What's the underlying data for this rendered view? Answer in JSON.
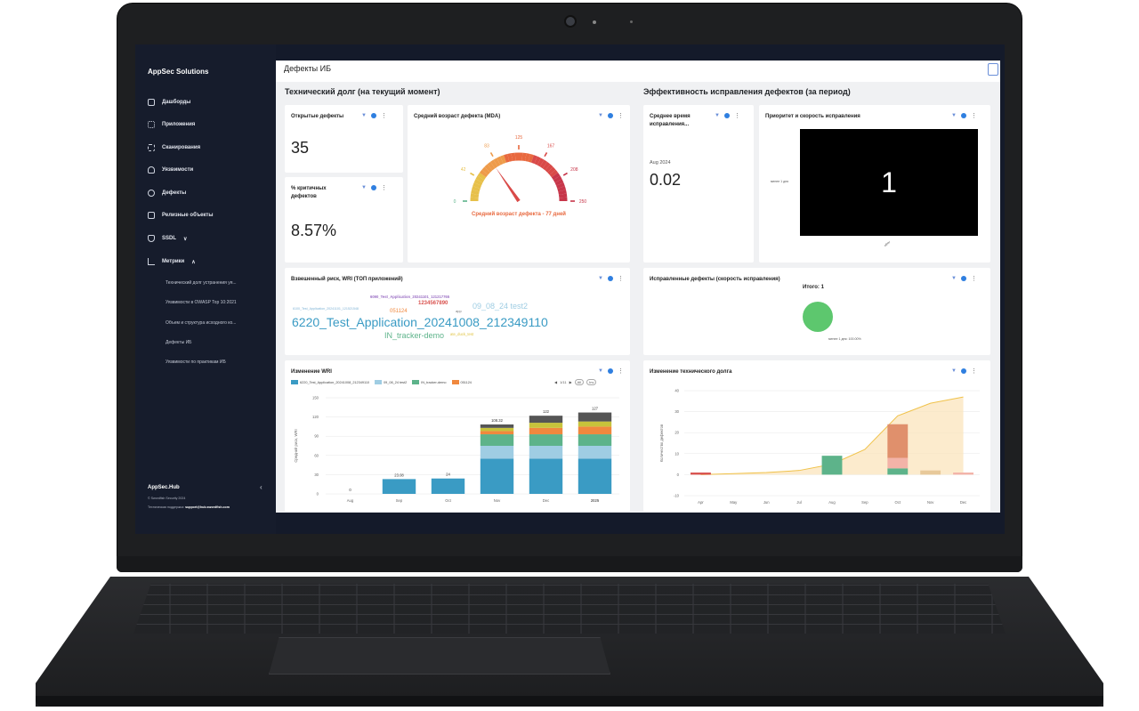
{
  "sidebar": {
    "brand": "AppSec Solutions",
    "items": [
      {
        "label": "Дашборды",
        "icon": "dashboard-icon"
      },
      {
        "label": "Приложения",
        "icon": "grid-icon"
      },
      {
        "label": "Сканирования",
        "icon": "scan-icon"
      },
      {
        "label": "Уязвимости",
        "icon": "bug-icon"
      },
      {
        "label": "Дефекты",
        "icon": "defect-icon"
      },
      {
        "label": "Релизные объекты",
        "icon": "release-icon"
      },
      {
        "label": "SSDL",
        "icon": "shield-icon"
      },
      {
        "label": "Метрики",
        "icon": "chart-icon"
      }
    ],
    "ssdl_caret": "∨",
    "metrics_caret": "∧",
    "subitems": [
      "Технический долг устранения уя...",
      "Уязвимости в OWASP Top 10:2021",
      "Объем и структура исходного ко...",
      "Дефекты ИБ",
      "Уязвимости по практикам ИБ"
    ],
    "hub": "AppSec.Hub",
    "hub_collapse": "‹",
    "copyright": "© Swordfish Security 2024",
    "support_label": "Техническая поддержка:",
    "support_email": "support@hub.swordfish.com"
  },
  "page": {
    "title": "Дефекты ИБ",
    "section_left": "Технический долг (на текущий момент)",
    "section_right": "Эффективность исправления дефектов (за период)"
  },
  "cards": {
    "open_defects": {
      "title": "Открытые дефекты",
      "value": "35"
    },
    "critical_pct": {
      "title": "% критичных дефектов",
      "value": "8.57%"
    },
    "mda": {
      "title": "Средний возраст дефекта (MDA)",
      "ticks": [
        "0",
        "42",
        "83",
        "125",
        "167",
        "208",
        "250"
      ],
      "caption": "Средний возраст дефекта - 77 дней",
      "value": 77,
      "max": 250
    },
    "avg_fix_time": {
      "title": "Среднее время исправления...",
      "period": "Aug 2024",
      "value": "0.02"
    },
    "priority_speed": {
      "title": "Приоритет и скорость исправления",
      "cell_value": "1",
      "row_label": "менее 1 дня",
      "col_label": "other"
    },
    "wri_top": {
      "title": "Взвешенный риск, WRI (ТОП приложений)",
      "words": [
        {
          "text": "6220_Test_Application_20241008_212349110",
          "color": "#3a9bc4"
        },
        {
          "text": "09_08_24 test2",
          "color": "#9fcde3"
        },
        {
          "text": "IN_tracker-demo",
          "color": "#5db38a"
        },
        {
          "text": "051124",
          "color": "#f0883e"
        },
        {
          "text": "1234567890",
          "color": "#d9534f"
        },
        {
          "text": "6090_Test_Application_20241101_121217765",
          "color": "#9b6fc4"
        },
        {
          "text": "6100_Test_Application_20241101_121521548",
          "color": "#7fb3d5"
        },
        {
          "text": "app",
          "color": "#777777"
        },
        {
          "text": "ate_duck_test",
          "color": "#e0c341"
        }
      ]
    },
    "fixed_defects": {
      "title": "Исправленные дефекты (скорость исправления)",
      "total": "Итого: 1",
      "slice_label": "менее 1 дня: 100.00%"
    },
    "wri_change": {
      "title": "Изменение WRI",
      "pager": "1/11",
      "all_btn": "All",
      "inv_btn": "Inv"
    },
    "tech_debt_change": {
      "title": "Изменение технического долга"
    }
  },
  "chart_data": [
    {
      "type": "bar",
      "title": "Изменение WRI",
      "ylabel": "Средний риск, WRI",
      "ylim": [
        0,
        150
      ],
      "yticks": [
        0,
        30,
        60,
        90,
        120,
        150
      ],
      "categories": [
        "Aug",
        "Sep",
        "Oct",
        "Nov",
        "Dec",
        "2025"
      ],
      "totals": [
        "0",
        "23.08",
        "24",
        "108.32",
        "122",
        "127"
      ],
      "legend_position": "top",
      "series": [
        {
          "name": "6220_Test_Application_20241008_212349110",
          "color": "#3a9bc4",
          "values": [
            0,
            23.08,
            24,
            55,
            55,
            55
          ]
        },
        {
          "name": "09_08_24 test2",
          "color": "#9fcde3",
          "values": [
            0,
            0,
            0,
            20,
            20,
            20
          ]
        },
        {
          "name": "IN_tracker-demo",
          "color": "#5db38a",
          "values": [
            0,
            0,
            0,
            18,
            18,
            18
          ]
        },
        {
          "name": "051124",
          "color": "#f0883e",
          "values": [
            0,
            0,
            0,
            5,
            10,
            12
          ]
        },
        {
          "name": "",
          "color": "#c7c33b",
          "values": [
            0,
            0,
            0,
            5,
            8,
            8
          ]
        },
        {
          "name": "",
          "color": "#555555",
          "values": [
            0,
            0,
            0,
            5.32,
            11,
            14
          ]
        }
      ]
    },
    {
      "type": "area",
      "title": "Изменение технического долга",
      "ylabel": "Количество дефектов",
      "ylim": [
        -10,
        40
      ],
      "yticks": [
        -10,
        0,
        10,
        20,
        30,
        40
      ],
      "categories": [
        "Apr",
        "May",
        "Jun",
        "Jul",
        "Aug",
        "Sep",
        "Oct",
        "Nov",
        "Dec"
      ],
      "line": [
        0,
        0.5,
        1,
        2,
        5,
        12,
        28,
        34,
        37
      ],
      "bars": [
        {
          "category": "Apr",
          "values": [
            {
              "v": 1,
              "color": "#d9534f"
            }
          ]
        },
        {
          "category": "Aug",
          "values": [
            {
              "v": 9,
              "color": "#5db38a"
            }
          ]
        },
        {
          "category": "Oct",
          "values": [
            {
              "v": 3,
              "color": "#5db38a"
            },
            {
              "v": 5,
              "color": "#f3b3a8"
            },
            {
              "v": 16,
              "color": "#e0906c"
            }
          ]
        },
        {
          "category": "Nov",
          "values": [
            {
              "v": 2,
              "color": "#e8c99a"
            }
          ]
        },
        {
          "category": "Dec",
          "values": [
            {
              "v": 1,
              "color": "#f3b3a8"
            }
          ]
        }
      ]
    }
  ]
}
